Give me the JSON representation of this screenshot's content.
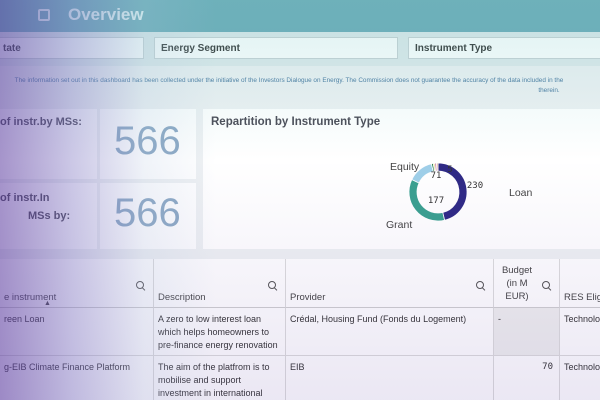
{
  "header": {
    "title": "Overview"
  },
  "filters": [
    {
      "label": "tate"
    },
    {
      "label": "Energy Segment"
    },
    {
      "label": "Instrument Type"
    }
  ],
  "disclaimer": {
    "line1": "The information set out in this dashboard has been collected under the initiative of the Investors Dialogue on Energy. The Commission does not guarantee the accuracy of the data included in the",
    "line2": "therein."
  },
  "kpis": [
    {
      "label_line1": "of instr.by MSs:",
      "label_line2": "",
      "value": "566"
    },
    {
      "label_line1": "of instr.In",
      "label_line2": "MSs by:",
      "value": "566"
    }
  ],
  "chart_data": {
    "type": "pie",
    "title": "Repartition by Instrument Type",
    "donut": true,
    "slices": [
      {
        "name": "Loan",
        "value": 230,
        "color": "#2f2a85"
      },
      {
        "name": "Grant",
        "value": 177,
        "color": "#3aa090"
      },
      {
        "name": "Equity",
        "value": 71,
        "color": "#9fcfe8"
      },
      {
        "name": "",
        "value": 5,
        "color": "#1f7a45"
      },
      {
        "name": "",
        "value": 4,
        "color": "#e7d46a"
      },
      {
        "name": "",
        "value": 5,
        "color": "#c67aa4"
      },
      {
        "name": "",
        "value": 4,
        "color": "#d9a58d"
      }
    ],
    "data_labels": [
      "230",
      "177",
      "71",
      "5"
    ]
  },
  "table": {
    "headers": [
      "e instrument",
      "Description",
      "Provider",
      "Budget (in M EUR)",
      "RES Eligi"
    ],
    "rows": [
      [
        "reen Loan",
        "A zero to low interest loan which helps homeowners to pre-finance energy renovation",
        "Crédal, Housing Fund (Fonds du Logement)",
        "-",
        "Technolo"
      ],
      [
        "g-EIB Climate Finance Platform",
        "The aim of the platfrom is to mobilise and support investment in international",
        "EIB",
        "70",
        "Technolo"
      ]
    ]
  }
}
